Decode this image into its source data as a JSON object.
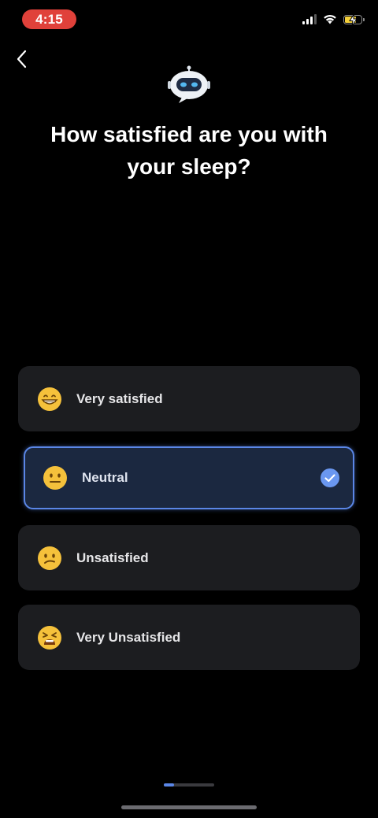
{
  "status_bar": {
    "time": "4:15",
    "icons": [
      "cellular-signal-icon",
      "wifi-icon",
      "battery-charging-icon"
    ]
  },
  "header": {
    "back_icon": "chevron-left-icon",
    "avatar_icon": "robot-icon"
  },
  "question": {
    "title": "How satisfied are you with your sleep?"
  },
  "options": [
    {
      "label": "Very satisfied",
      "emoji": "grinning-face",
      "selected": false
    },
    {
      "label": "Neutral",
      "emoji": "neutral-face",
      "selected": true
    },
    {
      "label": "Unsatisfied",
      "emoji": "confused-face",
      "selected": false
    },
    {
      "label": "Very Unsatisfied",
      "emoji": "tired-face",
      "selected": false
    }
  ],
  "progress": {
    "fraction": 0.2
  },
  "colors": {
    "background": "#000000",
    "card": "#1c1d20",
    "selected_card": "#1b2840",
    "accent": "#5a86e6",
    "status_pill": "#e0413a",
    "battery_fill": "#f4d03a"
  }
}
